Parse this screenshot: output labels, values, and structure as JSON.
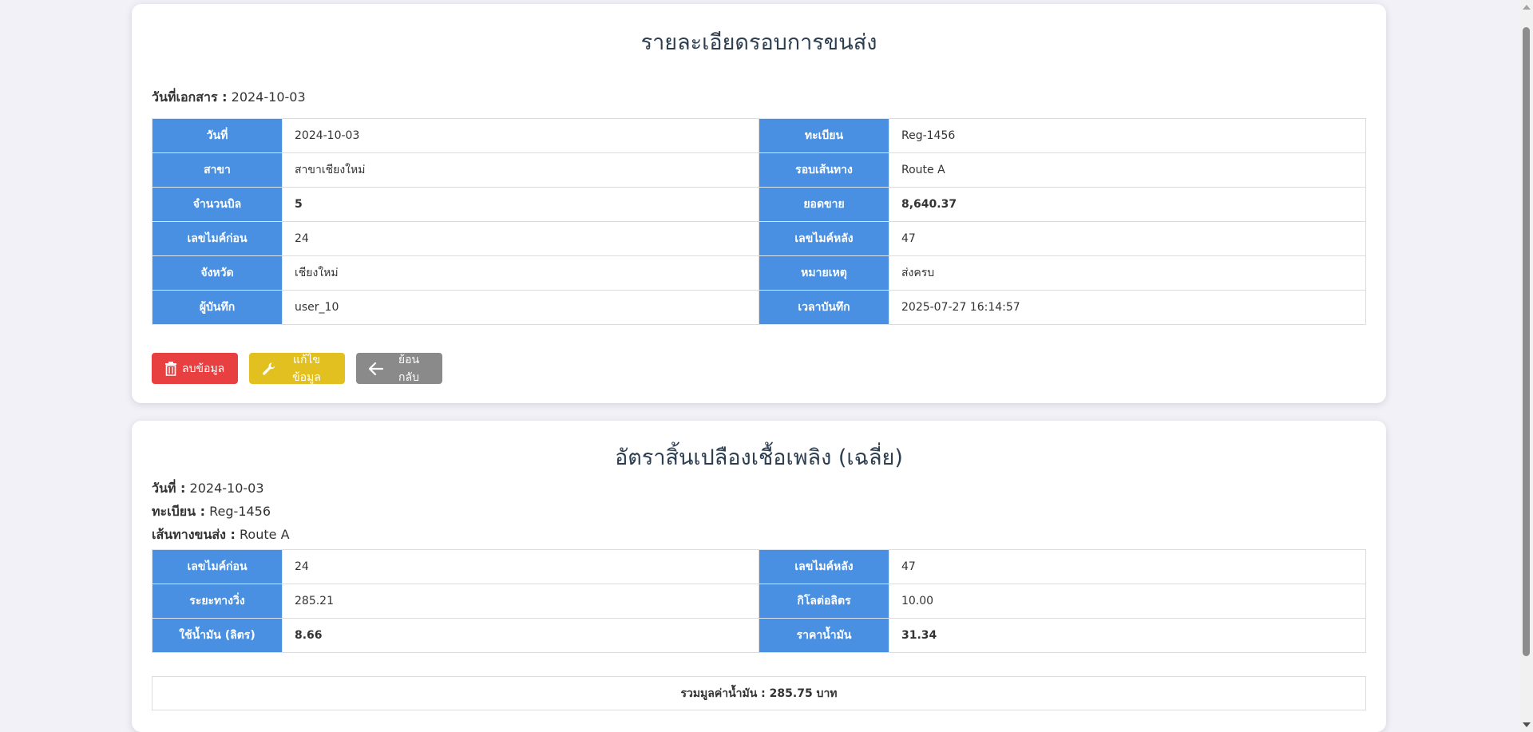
{
  "details": {
    "title": "รายละเอียดรอบการขนส่ง",
    "doc_date_label": "วันที่เอกสาร :",
    "doc_date_value": "2024-10-03",
    "rows": [
      {
        "l1": "วันที่",
        "v1": "2024-10-03",
        "l2": "ทะเบียน",
        "v2": "Reg-1456"
      },
      {
        "l1": "สาขา",
        "v1": "สาขาเชียงใหม่",
        "l2": "รอบเส้นทาง",
        "v2": "Route A"
      },
      {
        "l1": "จำนวนบิล",
        "v1": "5",
        "l2": "ยอดขาย",
        "v2": "8,640.37"
      },
      {
        "l1": "เลขไมค์ก่อน",
        "v1": "24",
        "l2": "เลขไมค์หลัง",
        "v2": "47"
      },
      {
        "l1": "จังหวัด",
        "v1": "เชียงใหม่",
        "l2": "หมายเหตุ",
        "v2": "ส่งครบ"
      },
      {
        "l1": "ผู้บันทึก",
        "v1": "user_10",
        "l2": "เวลาบันทึก",
        "v2": "2025-07-27 16:14:57"
      }
    ],
    "buttons": {
      "delete": "ลบข้อมูล",
      "edit": "แก้ไขข้อมูล",
      "back": "ย้อนกลับ"
    }
  },
  "fuel": {
    "title": "อัตราสิ้นเปลืองเชื้อเพลิง (เฉลี่ย)",
    "date_label": "วันที่ :",
    "date_value": "2024-10-03",
    "reg_label": "ทะเบียน :",
    "reg_value": "Reg-1456",
    "route_label": "เส้นทางขนส่ง :",
    "route_value": "Route A",
    "rows": [
      {
        "l1": "เลขไมค์ก่อน",
        "v1": "24",
        "l2": "เลขไมค์หลัง",
        "v2": "47"
      },
      {
        "l1": "ระยะทางวิ่ง",
        "v1": "285.21",
        "l2": "กิโลต่อลิตร",
        "v2": "10.00"
      },
      {
        "l1": "ใช้น้ำมัน (ลิตร)",
        "v1": "8.66",
        "l2": "ราคาน้ำมัน",
        "v2": "31.34"
      }
    ],
    "total": "รวมมูลค่าน้ำมัน : 285.75 บาท"
  },
  "colors": {
    "label_bg": "#4a90e2",
    "delete": "#e84040",
    "edit": "#e2c01f",
    "back": "#8a8a8a"
  },
  "icons": {
    "delete": "trash-icon",
    "edit": "wrench-icon",
    "back": "arrow-left-icon"
  }
}
